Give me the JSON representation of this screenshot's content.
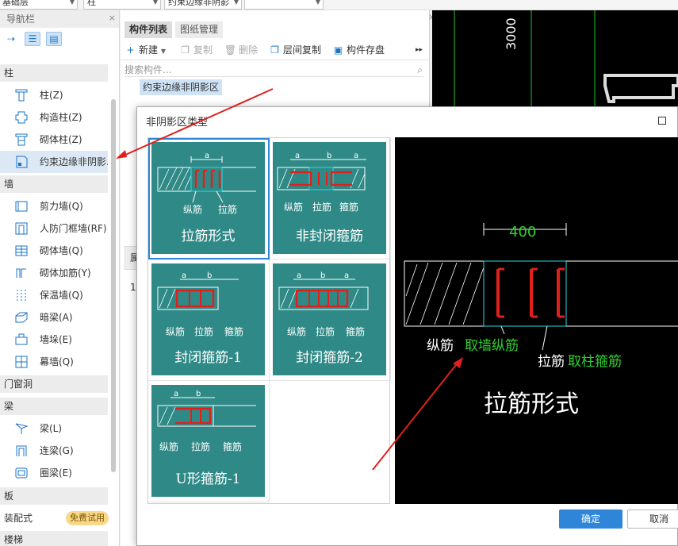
{
  "top_selects": [
    {
      "label": "基础层"
    },
    {
      "label": "柱"
    },
    {
      "label": "约束边缘非阴影"
    }
  ],
  "nav": {
    "title": "导航栏",
    "close": "×",
    "categories": {
      "column": "柱",
      "wall": "墙",
      "opening": "门窗洞",
      "beam": "梁",
      "slab": "板",
      "prefab": "装配式",
      "stair": "楼梯"
    },
    "trial_badge": "免费试用",
    "column_items": [
      "柱(Z)",
      "构造柱(Z)",
      "砌体柱(Z)",
      "约束边缘非阴影..."
    ],
    "wall_items": [
      "剪力墙(Q)",
      "人防门框墙(RF)",
      "砌体墙(Q)",
      "砌体加筋(Y)",
      "保温墙(Q)",
      "暗梁(A)",
      "墙垛(E)",
      "幕墙(Q)"
    ],
    "beam_items": [
      "梁(L)",
      "连梁(G)",
      "圈梁(E)"
    ]
  },
  "mid": {
    "close": "×",
    "tabs": [
      "构件列表",
      "图纸管理"
    ],
    "toolbar": {
      "new": "新建",
      "copy": "复制",
      "delete": "删除",
      "floor_copy": "层间复制",
      "save": "构件存盘"
    },
    "search_placeholder": "搜索构件...",
    "selected_component": "约束边缘非阴影区",
    "lower_header": "属",
    "lower_row": "1"
  },
  "cad": {
    "dim_text": "3000"
  },
  "dialog": {
    "title": "非阴影区类型",
    "options": [
      {
        "label": "拉筋形式",
        "dims": [
          "a"
        ],
        "annotations": [
          "纵筋",
          "拉筋"
        ],
        "selected": true
      },
      {
        "label": "非封闭箍筋",
        "dims": [
          "a",
          "b",
          "a"
        ],
        "annotations": [
          "纵筋",
          "拉筋",
          "箍筋"
        ],
        "selected": false
      },
      {
        "label": "封闭箍筋-1",
        "dims": [
          "a",
          "b"
        ],
        "annotations": [
          "纵筋",
          "拉筋",
          "箍筋"
        ],
        "selected": false
      },
      {
        "label": "封闭箍筋-2",
        "dims": [
          "a",
          "b",
          "a"
        ],
        "annotations": [
          "纵筋",
          "拉筋",
          "箍筋"
        ],
        "selected": false
      },
      {
        "label": "U形箍筋-1",
        "dims": [
          "a",
          "b"
        ],
        "annotations": [
          "纵筋",
          "拉筋",
          "箍筋"
        ],
        "selected": false
      }
    ],
    "preview": {
      "dimension": "400",
      "longitudinal_label": "纵筋",
      "longitudinal_value": "取墙纵筋",
      "tie_label": "拉筋",
      "tie_value": "取柱箍筋",
      "title": "拉筋形式"
    },
    "ok": "确定",
    "cancel": "取消"
  },
  "colors": {
    "accent": "#2f86d8",
    "card": "#2f8a87",
    "rebar": "#e0201b",
    "dim_green": "#2fd12f",
    "cyan": "#2bd8e0",
    "arrow": "#e0201b"
  }
}
